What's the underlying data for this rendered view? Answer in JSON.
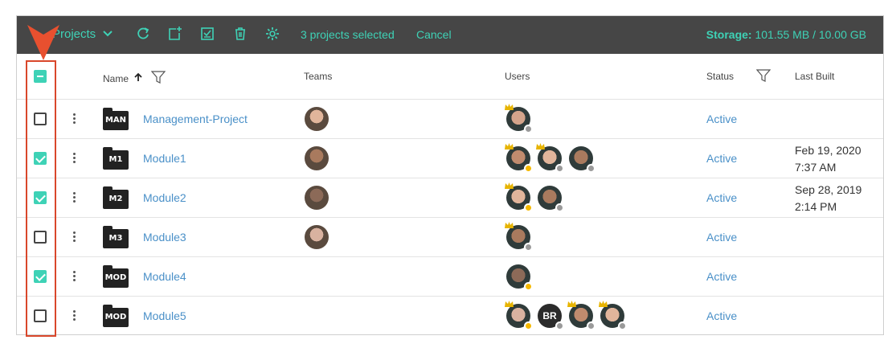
{
  "toolbar": {
    "projects_label": "Projects",
    "selected_text": "3 projects selected",
    "cancel_label": "Cancel",
    "storage_label": "Storage:",
    "storage_value": "101.55 MB / 10.00 GB",
    "icons": [
      "refresh-icon",
      "new-project-icon",
      "select-all-icon",
      "delete-icon",
      "settings-icon"
    ],
    "accent_color": "#3ed2b6",
    "background_color": "#464646"
  },
  "header": {
    "name": "Name",
    "teams": "Teams",
    "users": "Users",
    "status": "Status",
    "last_built": "Last Built",
    "sort_icon": "arrow-up-icon",
    "filter_icon": "filter-icon",
    "select_state": "partial"
  },
  "rows": [
    {
      "checked": false,
      "icon_label": "MAN",
      "name": "Management-Project",
      "status": "Active",
      "last_built_date": "",
      "last_built_time": "",
      "team_avatars": 1,
      "users": [
        {
          "type": "photo",
          "owner": true,
          "presence": "gray"
        }
      ]
    },
    {
      "checked": true,
      "icon_label": "M1",
      "name": "Module1",
      "status": "Active",
      "last_built_date": "Feb 19, 2020",
      "last_built_time": "7:37 AM",
      "team_avatars": 1,
      "users": [
        {
          "type": "photo",
          "owner": true,
          "presence": "yellow"
        },
        {
          "type": "photo",
          "owner": true,
          "presence": "gray"
        },
        {
          "type": "photo",
          "owner": false,
          "presence": "gray"
        }
      ]
    },
    {
      "checked": true,
      "icon_label": "M2",
      "name": "Module2",
      "status": "Active",
      "last_built_date": "Sep 28, 2019",
      "last_built_time": "2:14 PM",
      "team_avatars": 1,
      "users": [
        {
          "type": "photo",
          "owner": true,
          "presence": "yellow"
        },
        {
          "type": "photo",
          "owner": false,
          "presence": "gray"
        }
      ]
    },
    {
      "checked": false,
      "icon_label": "M3",
      "name": "Module3",
      "status": "Active",
      "last_built_date": "",
      "last_built_time": "",
      "team_avatars": 1,
      "users": [
        {
          "type": "photo",
          "owner": true,
          "presence": "gray"
        }
      ]
    },
    {
      "checked": true,
      "icon_label": "MOD",
      "name": "Module4",
      "status": "Active",
      "last_built_date": "",
      "last_built_time": "",
      "team_avatars": 0,
      "users": [
        {
          "type": "photo",
          "owner": false,
          "presence": "yellow"
        }
      ]
    },
    {
      "checked": false,
      "icon_label": "MOD",
      "name": "Module5",
      "status": "Active",
      "last_built_date": "",
      "last_built_time": "",
      "team_avatars": 0,
      "users": [
        {
          "type": "photo",
          "owner": true,
          "presence": "yellow"
        },
        {
          "type": "initials",
          "initials": "BR",
          "owner": false,
          "presence": "gray"
        },
        {
          "type": "photo",
          "owner": true,
          "presence": "gray"
        },
        {
          "type": "photo",
          "owner": true,
          "presence": "gray"
        }
      ]
    }
  ],
  "colors": {
    "link": "#4a90c8",
    "presence_yellow": "#f5b800",
    "presence_gray": "#9a9a9a",
    "crown": "#e7b400",
    "highlight": "#d9472b"
  }
}
